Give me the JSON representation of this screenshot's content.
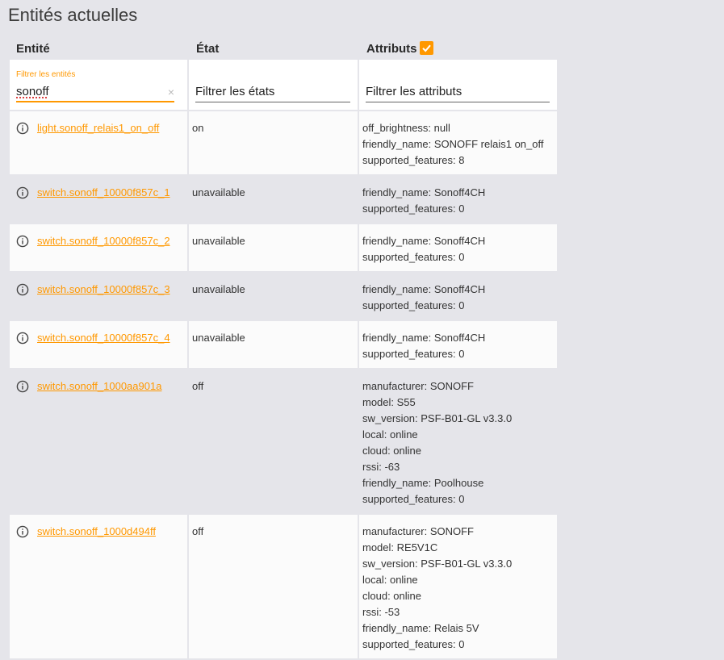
{
  "page_title": "Entités actuelles",
  "headers": {
    "entity": "Entité",
    "state": "État",
    "attributes": "Attributs"
  },
  "filters": {
    "entity_label": "Filtrer les entités",
    "entity_value": "sonoff",
    "clear_glyph": "×",
    "state_placeholder": "Filtrer les états",
    "attributes_placeholder": "Filtrer les attributs"
  },
  "colors": {
    "accent": "#ff9800"
  },
  "rows": [
    {
      "entity": "light.sonoff_relais1_on_off",
      "state": "on",
      "shade": "white",
      "attributes": [
        "off_brightness: null",
        "friendly_name: SONOFF relais1 on_off",
        "supported_features: 8"
      ]
    },
    {
      "entity": "switch.sonoff_10000f857c_1",
      "state": "unavailable",
      "shade": "grey",
      "attributes": [
        "friendly_name: Sonoff4CH",
        "supported_features: 0"
      ]
    },
    {
      "entity": "switch.sonoff_10000f857c_2",
      "state": "unavailable",
      "shade": "white",
      "attributes": [
        "friendly_name: Sonoff4CH",
        "supported_features: 0"
      ]
    },
    {
      "entity": "switch.sonoff_10000f857c_3",
      "state": "unavailable",
      "shade": "grey",
      "attributes": [
        "friendly_name: Sonoff4CH",
        "supported_features: 0"
      ]
    },
    {
      "entity": "switch.sonoff_10000f857c_4",
      "state": "unavailable",
      "shade": "white",
      "attributes": [
        "friendly_name: Sonoff4CH",
        "supported_features: 0"
      ]
    },
    {
      "entity": "switch.sonoff_1000aa901a",
      "state": "off",
      "shade": "grey",
      "attributes": [
        "manufacturer: SONOFF",
        "model: S55",
        "sw_version: PSF-B01-GL v3.3.0",
        "local: online",
        "cloud: online",
        "rssi: -63",
        "friendly_name: Poolhouse",
        "supported_features: 0"
      ]
    },
    {
      "entity": "switch.sonoff_1000d494ff",
      "state": "off",
      "shade": "white",
      "attributes": [
        "manufacturer: SONOFF",
        "model: RE5V1C",
        "sw_version: PSF-B01-GL v3.3.0",
        "local: online",
        "cloud: online",
        "rssi: -53",
        "friendly_name: Relais 5V",
        "supported_features: 0"
      ]
    }
  ]
}
